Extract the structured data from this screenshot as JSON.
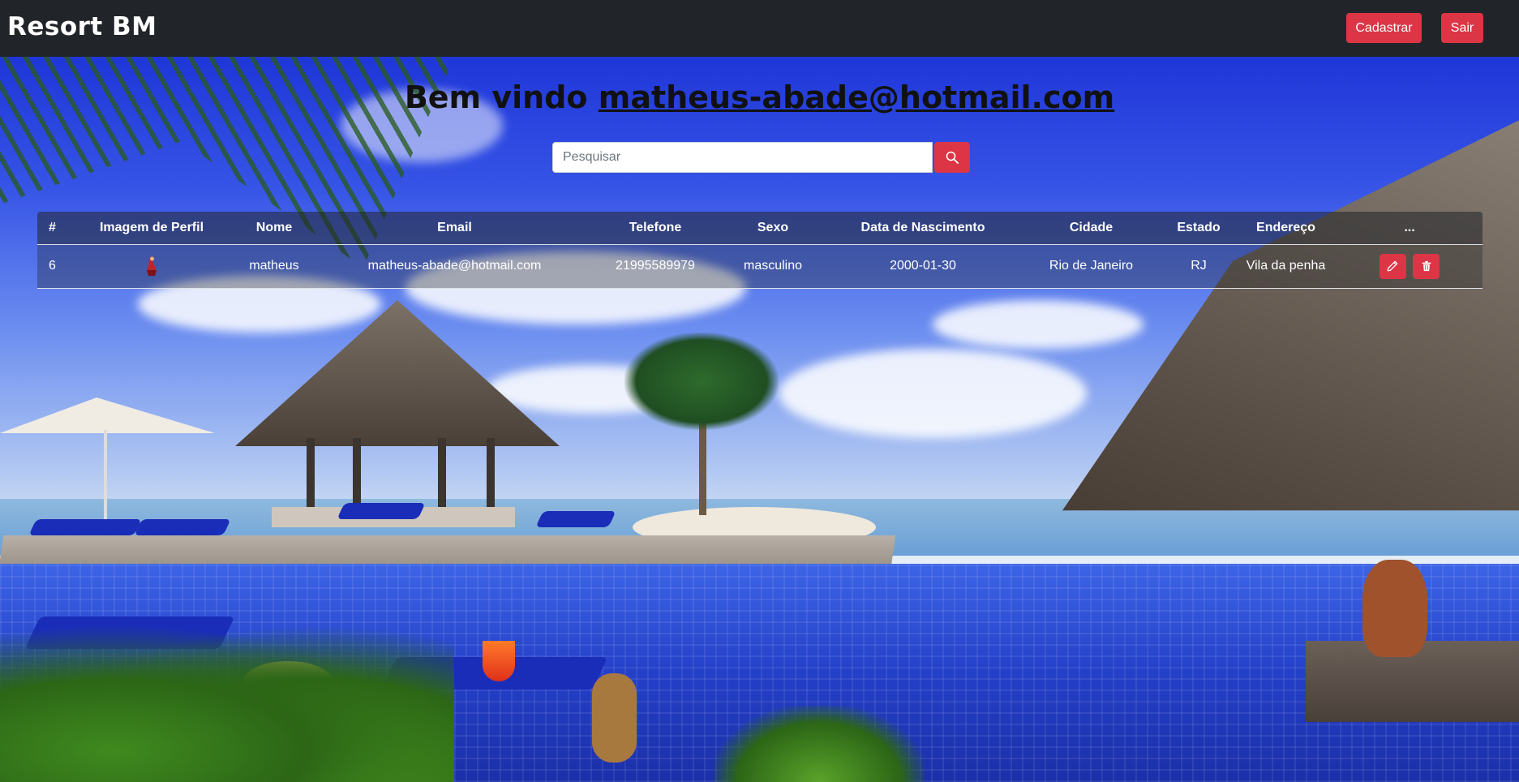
{
  "navbar": {
    "brand": "Resort BM",
    "cadastrar_label": "Cadastrar",
    "sair_label": "Sair"
  },
  "welcome": {
    "prefix": "Bem vindo",
    "email": "matheus-abade@hotmail.com"
  },
  "search": {
    "placeholder": "Pesquisar",
    "button_icon": "search-icon"
  },
  "table": {
    "headers": [
      "#",
      "Imagem de Perfil",
      "Nome",
      "Email",
      "Telefone",
      "Sexo",
      "Data de Nascimento",
      "Cidade",
      "Estado",
      "Endereço",
      "..."
    ],
    "rows": [
      {
        "id": "6",
        "avatar": "profile-image",
        "nome": "matheus",
        "email": "matheus-abade@hotmail.com",
        "telefone": "21995589979",
        "sexo": "masculino",
        "nascimento": "2000-01-30",
        "cidade": "Rio de Janeiro",
        "estado": "RJ",
        "endereco": "Vila da penha",
        "actions": [
          "pencil-icon",
          "trash-icon"
        ]
      }
    ]
  },
  "colors": {
    "navbar_bg": "#212529",
    "accent_red": "#dc3545"
  }
}
